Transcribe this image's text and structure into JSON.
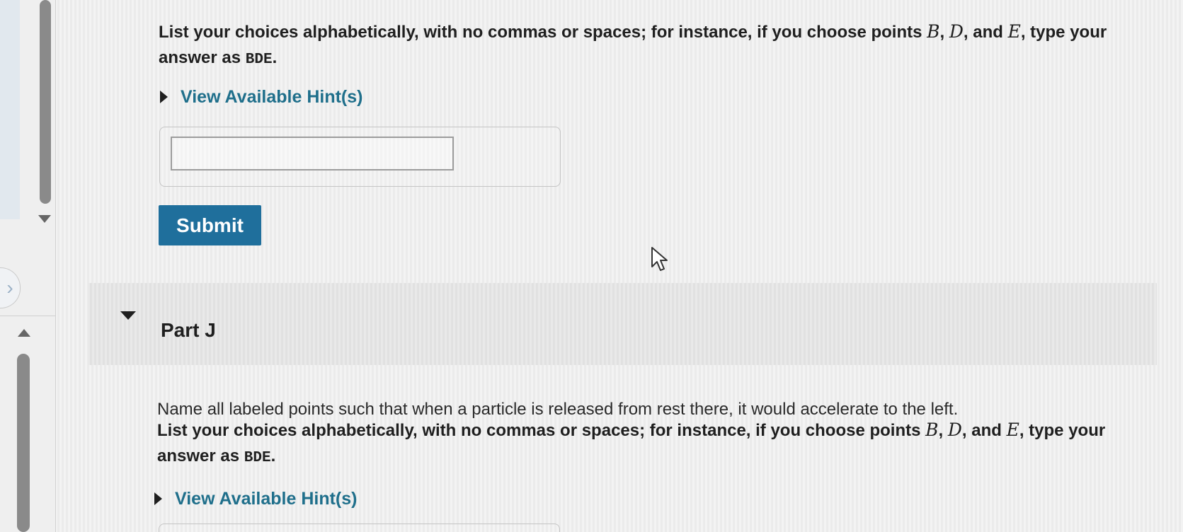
{
  "instruction_prefix": "List your choices alphabetically, with no commas or spaces; for instance, if you choose points ",
  "point_b": "B",
  "comma_1": ", ",
  "point_d": "D",
  "comma_2": ", and ",
  "point_e": "E",
  "instruction_suffix": ", type your answer as ",
  "example_answer": "BDE",
  "period": ".",
  "hint_label": "View Available Hint(s)",
  "answer_input": {
    "value": "",
    "placeholder": ""
  },
  "submit_label": "Submit",
  "part": {
    "title": "Part J",
    "question": "Name all labeled points such that when a particle is released from rest there, it would accelerate to the left."
  },
  "side_toggle_glyph": "›",
  "colors": {
    "link": "#1f6f8b",
    "submit_background": "#1f6f9c",
    "text": "#1f1f1f"
  },
  "icons": {
    "hint_toggle": "caret-right-icon",
    "part_toggle": "caret-down-icon",
    "scroll_down": "scroll-down-arrow-icon",
    "scroll_up": "scroll-up-arrow-icon",
    "cursor": "mouse-pointer-icon"
  }
}
